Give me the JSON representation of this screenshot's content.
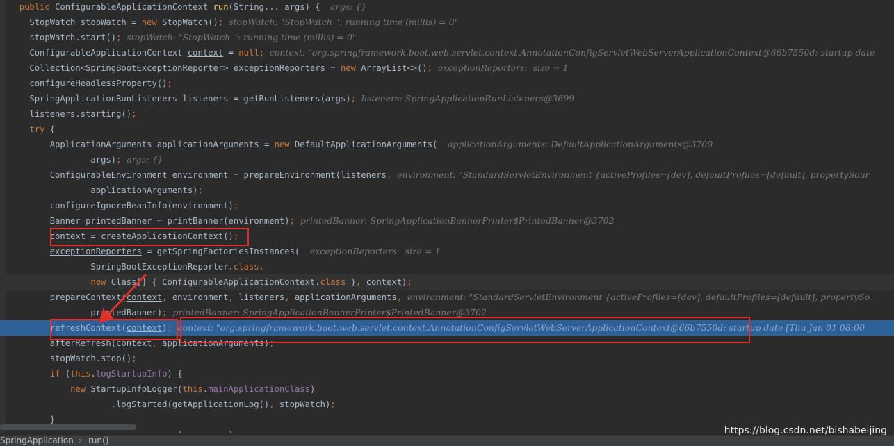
{
  "editor": {
    "lines": [
      {
        "indent": "  ",
        "tokens": [
          {
            "t": "public ",
            "c": "kw"
          },
          {
            "t": "ConfigurableApplicationContext "
          },
          {
            "t": "run",
            "c": "fn"
          },
          {
            "t": "(String... args) {  "
          },
          {
            "t": "args: {}",
            "c": "hint"
          }
        ]
      },
      {
        "indent": "    ",
        "tokens": [
          {
            "t": "StopWatch stopWatch = "
          },
          {
            "t": "new ",
            "c": "kw"
          },
          {
            "t": "StopWatch()"
          },
          {
            "t": ";",
            "c": "kw"
          },
          {
            "t": "  stopWatch: \"StopWatch '': running time (millis) = 0\"",
            "c": "hint"
          }
        ]
      },
      {
        "indent": "    ",
        "tokens": [
          {
            "t": "stopWatch.start()"
          },
          {
            "t": ";",
            "c": "kw"
          },
          {
            "t": "  stopWatch: \"StopWatch '': running time (millis) = 0\"",
            "c": "hint"
          }
        ]
      },
      {
        "indent": "    ",
        "tokens": [
          {
            "t": "ConfigurableApplicationContext "
          },
          {
            "t": "context",
            "c": "ul"
          },
          {
            "t": " = "
          },
          {
            "t": "null",
            "c": "kw"
          },
          {
            "t": ";",
            "c": "kw"
          },
          {
            "t": "  context: \"org.springframework.boot.web.servlet.context.AnnotationConfigServletWebServerApplicationContext@66b7550d: startup date",
            "c": "hint"
          }
        ]
      },
      {
        "indent": "    ",
        "tokens": [
          {
            "t": "Collection<SpringBootExceptionReporter> "
          },
          {
            "t": "exceptionReporters",
            "c": "ul"
          },
          {
            "t": " = "
          },
          {
            "t": "new ",
            "c": "kw"
          },
          {
            "t": "ArrayList<>()"
          },
          {
            "t": ";",
            "c": "kw"
          },
          {
            "t": "  exceptionReporters:  size = 1",
            "c": "hint"
          }
        ]
      },
      {
        "indent": "    ",
        "tokens": [
          {
            "t": "configureHeadlessProperty()"
          },
          {
            "t": ";",
            "c": "kw"
          }
        ]
      },
      {
        "indent": "    ",
        "tokens": [
          {
            "t": "SpringApplicationRunListeners listeners = getRunListeners(args)"
          },
          {
            "t": ";",
            "c": "kw"
          },
          {
            "t": "  listeners: SpringApplicationRunListeners@3699",
            "c": "hint"
          }
        ]
      },
      {
        "indent": "    ",
        "tokens": [
          {
            "t": "listeners.starting()"
          },
          {
            "t": ";",
            "c": "kw"
          }
        ]
      },
      {
        "indent": "    ",
        "tokens": [
          {
            "t": "try ",
            "c": "kw"
          },
          {
            "t": "{"
          }
        ]
      },
      {
        "indent": "        ",
        "tokens": [
          {
            "t": "ApplicationArguments applicationArguments = "
          },
          {
            "t": "new ",
            "c": "kw"
          },
          {
            "t": "DefaultApplicationArguments(  "
          },
          {
            "t": "applicationArguments: DefaultApplicationArguments@3700",
            "c": "hint"
          }
        ]
      },
      {
        "indent": "                ",
        "tokens": [
          {
            "t": "args)"
          },
          {
            "t": ";",
            "c": "kw"
          },
          {
            "t": "  args: {}",
            "c": "hint"
          }
        ]
      },
      {
        "indent": "        ",
        "tokens": [
          {
            "t": "ConfigurableEnvironment environment = prepareEnvironment(listeners"
          },
          {
            "t": ",",
            "c": "kw"
          },
          {
            "t": "  environment: \"StandardServletEnvironment {activeProfiles=[dev], defaultProfiles=[default], propertySour",
            "c": "hint"
          }
        ]
      },
      {
        "indent": "                ",
        "tokens": [
          {
            "t": "applicationArguments)"
          },
          {
            "t": ";",
            "c": "kw"
          }
        ]
      },
      {
        "indent": "        ",
        "tokens": [
          {
            "t": "configureIgnoreBeanInfo(environment)"
          },
          {
            "t": ";",
            "c": "kw"
          }
        ]
      },
      {
        "indent": "        ",
        "tokens": [
          {
            "t": "Banner printedBanner = printBanner(environment)"
          },
          {
            "t": ";",
            "c": "kw"
          },
          {
            "t": "  printedBanner: SpringApplicationBannerPrinter$PrintedBanner@3702",
            "c": "hint"
          }
        ]
      },
      {
        "indent": "        ",
        "tokens": [
          {
            "t": "context",
            "c": "ul"
          },
          {
            "t": " = createApplicationContext()"
          },
          {
            "t": ";",
            "c": "kw"
          }
        ]
      },
      {
        "indent": "        ",
        "tokens": [
          {
            "t": "exceptionReporters",
            "c": "ul"
          },
          {
            "t": " = getSpringFactoriesInstances(  "
          },
          {
            "t": "exceptionReporters:  size = 1",
            "c": "hint"
          }
        ]
      },
      {
        "indent": "                ",
        "tokens": [
          {
            "t": "SpringBootExceptionReporter."
          },
          {
            "t": "class",
            "c": "kw"
          },
          {
            "t": ",",
            "c": "kw"
          }
        ]
      },
      {
        "indent": "                ",
        "tokens": [
          {
            "t": "new ",
            "c": "kw"
          },
          {
            "t": "Class[] { ConfigurableApplicationContext."
          },
          {
            "t": "class ",
            "c": "kw"
          },
          {
            "t": "}"
          },
          {
            "t": ", ",
            "c": "kw"
          },
          {
            "t": "context",
            "c": "ul"
          },
          {
            "t": ")"
          },
          {
            "t": ";",
            "c": "kw"
          }
        ]
      },
      {
        "indent": "        ",
        "tokens": [
          {
            "t": "prepareContext("
          },
          {
            "t": "context",
            "c": "ul"
          },
          {
            "t": ", ",
            "c": "kw"
          },
          {
            "t": "environment"
          },
          {
            "t": ", ",
            "c": "kw"
          },
          {
            "t": "listeners"
          },
          {
            "t": ", ",
            "c": "kw"
          },
          {
            "t": "applicationArguments"
          },
          {
            "t": ",",
            "c": "kw"
          },
          {
            "t": "  environment: \"StandardServletEnvironment {activeProfiles=[dev], defaultProfiles=[default], propertySo",
            "c": "hint"
          }
        ]
      },
      {
        "indent": "                ",
        "tokens": [
          {
            "t": "printedBanner)"
          },
          {
            "t": ";",
            "c": "kw"
          },
          {
            "t": "  printedBanner: SpringApplicationBannerPrinter$PrintedBanner@3702",
            "c": "hint"
          }
        ]
      },
      {
        "indent": "        ",
        "tokens": [
          {
            "t": "refreshContext("
          },
          {
            "t": "context",
            "c": "ul"
          },
          {
            "t": ")"
          },
          {
            "t": ";",
            "c": "kw"
          },
          {
            "t": "  context: \"org.springframework.boot.web.servlet.context.AnnotationConfigServletWebServerApplicationContext@66b7550d: startup date [Thu Jan 01 08:00",
            "c": "hint"
          }
        ]
      },
      {
        "indent": "        ",
        "tokens": [
          {
            "t": "afterRefresh("
          },
          {
            "t": "context",
            "c": "ul"
          },
          {
            "t": ", ",
            "c": "kw"
          },
          {
            "t": "applicationArguments)"
          },
          {
            "t": ";",
            "c": "kw"
          }
        ]
      },
      {
        "indent": "        ",
        "tokens": [
          {
            "t": "stopWatch.stop()"
          },
          {
            "t": ";",
            "c": "kw"
          }
        ]
      },
      {
        "indent": "        ",
        "tokens": [
          {
            "t": "if ",
            "c": "kw"
          },
          {
            "t": "("
          },
          {
            "t": "this",
            "c": "kw"
          },
          {
            "t": "."
          },
          {
            "t": "logStartupInfo",
            "c": "fld"
          },
          {
            "t": ") {"
          }
        ]
      },
      {
        "indent": "            ",
        "tokens": [
          {
            "t": "new ",
            "c": "kw"
          },
          {
            "t": "StartupInfoLogger("
          },
          {
            "t": "this",
            "c": "kw"
          },
          {
            "t": "."
          },
          {
            "t": "mainApplicationClass",
            "c": "fld"
          },
          {
            "t": ")"
          }
        ]
      },
      {
        "indent": "                    ",
        "tokens": [
          {
            "t": ".logStarted(getApplicationLog()"
          },
          {
            "t": ", ",
            "c": "kw"
          },
          {
            "t": "stopWatch)"
          },
          {
            "t": ";",
            "c": "kw"
          }
        ]
      },
      {
        "indent": "        ",
        "tokens": [
          {
            "t": "}"
          }
        ]
      },
      {
        "indent": "        ",
        "tokens": [
          {
            "t": "                         ("
          },
          {
            "t": "         ",
            "c": "kw"
          },
          {
            "t": ")"
          }
        ]
      }
    ]
  },
  "status_bar": {
    "crumb_class": "SpringApplication",
    "separator": "›",
    "crumb_method": "run()"
  },
  "watermark": "https://blog.csdn.net/bishabeijing",
  "colors": {
    "background": "#2b2b2b",
    "exec_line": "#2d6099",
    "highlight_box": "#e1302a",
    "keyword": "#cc7832",
    "method": "#ffc66d",
    "field": "#9876aa",
    "hint": "#787878"
  }
}
